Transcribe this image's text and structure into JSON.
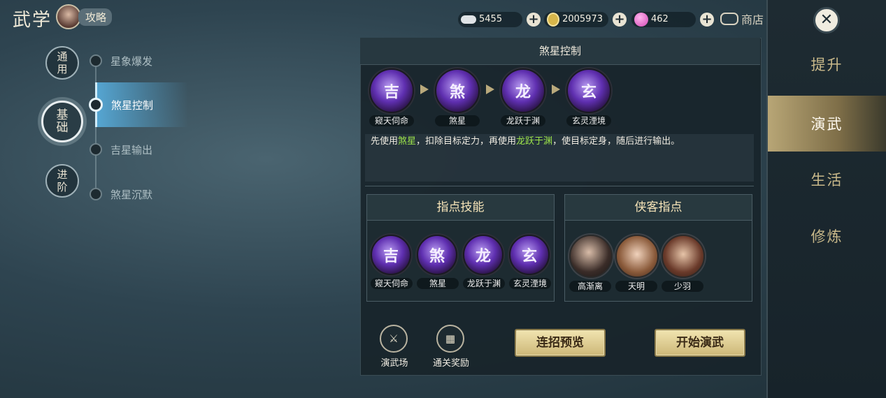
{
  "header": {
    "title": "武学",
    "guide_label": "攻略",
    "currencies": [
      {
        "icon": "silver-ingot-icon",
        "value": "5455"
      },
      {
        "icon": "gold-coin-icon",
        "value": "2005973"
      },
      {
        "icon": "pink-gem-icon",
        "value": "462"
      }
    ],
    "shop_label": "商店"
  },
  "sidebar": {
    "tabs": [
      "提升",
      "演武",
      "生活",
      "修炼"
    ],
    "active_tab": "演武"
  },
  "nav": {
    "categories": [
      "通用",
      "基础",
      "进阶"
    ],
    "active_category": "基础",
    "items": [
      "星象爆发",
      "煞星控制",
      "吉星输出",
      "煞星沉默"
    ],
    "active_item": "煞星控制"
  },
  "panel": {
    "title": "煞星控制",
    "combo_skills": [
      {
        "name": "窥天伺命",
        "glyph": "吉"
      },
      {
        "name": "煞星",
        "glyph": "煞"
      },
      {
        "name": "龙跃于渊",
        "glyph": "龙"
      },
      {
        "name": "玄灵湮境",
        "glyph": "玄"
      }
    ],
    "description": {
      "p1": "先使用",
      "h1": "煞星",
      "p2": "，扣除目标定力，再使用",
      "h2": "龙跃于渊",
      "p3": "，使目标定身，随后进行输出。"
    },
    "guide_skills": {
      "title": "指点技能",
      "skills": [
        "窥天伺命",
        "煞星",
        "龙跃于渊",
        "玄灵湮境"
      ]
    },
    "guide_heroes": {
      "title": "侠客指点",
      "heroes": [
        "高渐离",
        "天明",
        "少羽"
      ]
    },
    "bottom": {
      "arena_label": "演武场",
      "reward_label": "通关奖励",
      "preview_button": "连招预览",
      "start_button": "开始演武"
    }
  },
  "colors": {
    "highlight": "#9ce24a",
    "active_nav": "#5ab4e6",
    "gold_button": "#cdb778"
  }
}
